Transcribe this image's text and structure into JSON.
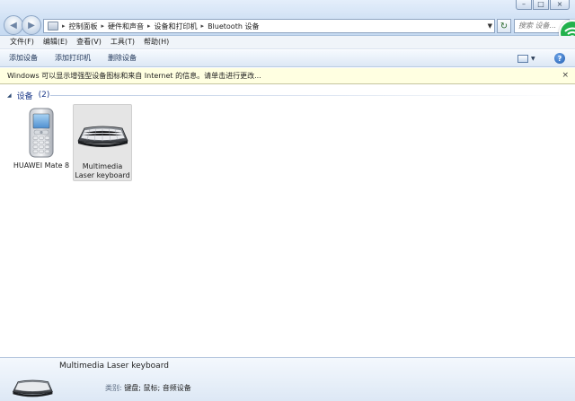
{
  "window": {
    "controls": [
      "minimize",
      "maximize",
      "close"
    ]
  },
  "address": {
    "crumbs": [
      "控制面板",
      "硬件和声音",
      "设备和打印机",
      "Bluetooth 设备"
    ],
    "search_placeholder": "搜索 设备..."
  },
  "menu": {
    "items": [
      "文件(F)",
      "编辑(E)",
      "查看(V)",
      "工具(T)",
      "帮助(H)"
    ]
  },
  "commands": {
    "add_device": "添加设备",
    "add_printer": "添加打印机",
    "remove_device": "删除设备"
  },
  "infobar": {
    "message": "Windows 可以显示增强型设备图标和来自 Internet 的信息。请单击进行更改...",
    "close_glyph": "×"
  },
  "group": {
    "title": "设备",
    "count": "(2)"
  },
  "devices": [
    {
      "label": "HUAWEI Mate 8",
      "icon": "mobile-phone-icon"
    },
    {
      "label": "Multimedia Laser keyboard",
      "icon": "keyboard-icon",
      "selected": true
    }
  ],
  "details": {
    "name": "Multimedia Laser keyboard",
    "category_label": "类别:",
    "category_value": "键盘; 鼠标; 音频设备"
  },
  "colors": {
    "accent": "#1e3b8a",
    "infobar_bg": "#ffffe1",
    "wifi_badge": "#22b14c"
  }
}
